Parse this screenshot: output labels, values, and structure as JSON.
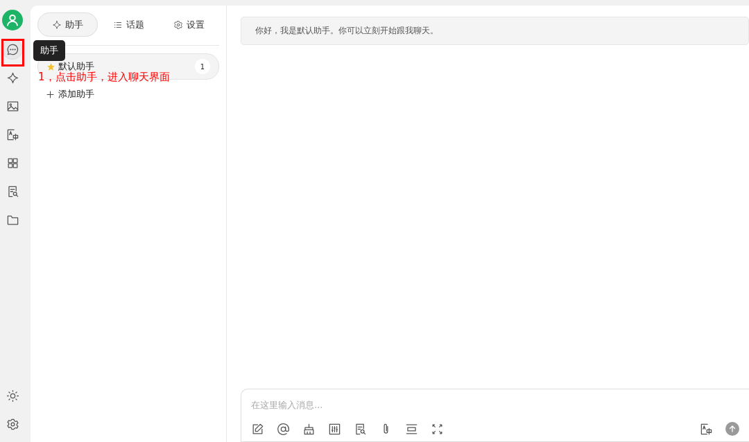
{
  "rail": [
    {
      "kind": "chat",
      "selected": true
    },
    {
      "kind": "sparkle",
      "selected": false
    },
    {
      "kind": "image",
      "selected": false
    },
    {
      "kind": "translate",
      "selected": false
    },
    {
      "kind": "grid",
      "selected": false
    },
    {
      "kind": "doc-search",
      "selected": false
    },
    {
      "kind": "folder",
      "selected": false
    }
  ],
  "rail_bottom": [
    {
      "kind": "sun"
    },
    {
      "kind": "gear"
    }
  ],
  "tooltip": "助手",
  "annotation": "1，点击助手，进入聊天界面",
  "tabs": [
    {
      "label": "助手",
      "kind": "sparkle",
      "selected": true
    },
    {
      "label": "话题",
      "kind": "list",
      "selected": false
    },
    {
      "label": "设置",
      "kind": "gear",
      "selected": false
    }
  ],
  "assistants": [
    {
      "name": "默认助手",
      "count": "1",
      "selected": true
    }
  ],
  "add_assistant": "添加助手",
  "message": "你好，我是默认助手。你可以立刻开始跟我聊天。",
  "input": {
    "placeholder": "在这里输入消息..."
  },
  "toolbar": [
    {
      "kind": "edit"
    },
    {
      "kind": "at"
    },
    {
      "kind": "broom"
    },
    {
      "kind": "sliders"
    },
    {
      "kind": "doc-search"
    },
    {
      "kind": "clip"
    },
    {
      "kind": "expand-rows"
    },
    {
      "kind": "fullscreen"
    }
  ],
  "toolbar_right": [
    {
      "kind": "translate"
    },
    {
      "kind": "send"
    }
  ]
}
